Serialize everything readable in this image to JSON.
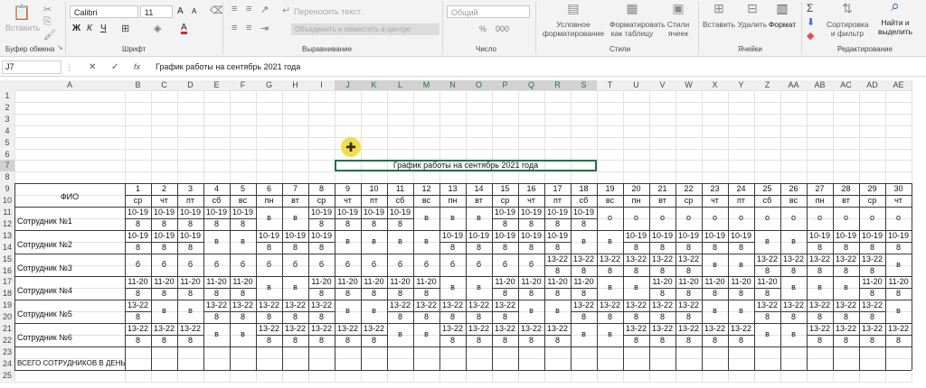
{
  "ribbon": {
    "clipboard": {
      "paste": "Вставить",
      "group": "Буфер обмена"
    },
    "font": {
      "name": "Calibri",
      "size": "11",
      "bold": "Ж",
      "italic": "К",
      "underline": "Ч",
      "grow": "A",
      "shrink": "A",
      "color_letter": "A",
      "group": "Шрифт"
    },
    "alignment": {
      "wrap": "Переносить текст",
      "merge": "Объединить и поместить в центре",
      "group": "Выравнивание"
    },
    "number": {
      "format": "Общий",
      "percent": "%",
      "thousands": "000",
      "group": "Число"
    },
    "styles": {
      "conditional": "Условное форматирование",
      "as_table": "Форматировать как таблицу",
      "cell_styles": "Стили ячеек",
      "group": "Стили"
    },
    "cells": {
      "insert": "Вставить",
      "delete": "Удалить",
      "format": "Формат",
      "group": "Ячейки"
    },
    "editing": {
      "sort": "Сортировка и фильтр",
      "find": "Найти и выделить",
      "group": "Редактирование"
    }
  },
  "formula_bar": {
    "name_box": "J7",
    "fx": "fx",
    "cancel": "✕",
    "enter": "✓",
    "content": "График работы на сентябрь 2021 года"
  },
  "sheet": {
    "columns": [
      "A",
      "B",
      "C",
      "D",
      "E",
      "F",
      "G",
      "H",
      "I",
      "J",
      "K",
      "L",
      "M",
      "N",
      "O",
      "P",
      "Q",
      "R",
      "S",
      "T",
      "U",
      "V",
      "W",
      "X",
      "Y",
      "Z",
      "AA",
      "AB",
      "AC",
      "AD",
      "AE"
    ],
    "rows": [
      "1",
      "2",
      "3",
      "4",
      "5",
      "6",
      "7",
      "8",
      "9",
      "10",
      "11",
      "12",
      "13",
      "14",
      "15",
      "16",
      "17",
      "18",
      "19",
      "20",
      "21",
      "22",
      "23",
      "24",
      "25"
    ],
    "title": "График работы на сентябрь 2021 года",
    "fio_label": "ФИО",
    "total_label": "ВСЕГО СОТРУДНИКОВ В ДЕНЬ",
    "days": [
      "1",
      "2",
      "3",
      "4",
      "5",
      "6",
      "7",
      "8",
      "9",
      "10",
      "11",
      "12",
      "13",
      "14",
      "15",
      "16",
      "17",
      "18",
      "19",
      "20",
      "21",
      "22",
      "23",
      "24",
      "25",
      "26",
      "27",
      "28",
      "29",
      "30"
    ],
    "weekdays": [
      "ср",
      "чт",
      "пт",
      "сб",
      "вс",
      "пн",
      "вт",
      "ср",
      "чт",
      "пт",
      "сб",
      "вс",
      "пн",
      "вт",
      "ср",
      "чт",
      "пт",
      "сб",
      "вс",
      "пн",
      "вт",
      "ср",
      "чт",
      "пт",
      "сб",
      "вс",
      "пн",
      "вт",
      "ср",
      "чт"
    ],
    "employees": [
      {
        "name": "Сотрудник №1",
        "days": [
          [
            "10-19",
            "8"
          ],
          [
            "10-19",
            "8"
          ],
          [
            "10-19",
            "8"
          ],
          [
            "10-19",
            "8"
          ],
          [
            "10-19",
            "8"
          ],
          [
            "в"
          ],
          [
            "в"
          ],
          [
            "10-19",
            "8"
          ],
          [
            "10-19",
            "8"
          ],
          [
            "10-19",
            "8"
          ],
          [
            "10-19",
            "8"
          ],
          [
            "в"
          ],
          [
            "в"
          ],
          [
            "в"
          ],
          [
            "10-19",
            "8"
          ],
          [
            "10-19",
            "8"
          ],
          [
            "10-19",
            "8"
          ],
          [
            "10-19",
            "8"
          ],
          [
            "о"
          ],
          [
            "о"
          ],
          [
            "о"
          ],
          [
            "о"
          ],
          [
            "о"
          ],
          [
            "о"
          ],
          [
            "о"
          ],
          [
            "о"
          ],
          [
            "о"
          ],
          [
            "о"
          ],
          [
            "о"
          ],
          [
            "о"
          ]
        ]
      },
      {
        "name": "Сотрудник №2",
        "days": [
          [
            "10-19",
            "8"
          ],
          [
            "10-19",
            "8"
          ],
          [
            "10-19",
            "8"
          ],
          [
            "в"
          ],
          [
            "в"
          ],
          [
            "10-19",
            "8"
          ],
          [
            "10-19",
            "8"
          ],
          [
            "10-19",
            "8"
          ],
          [
            "в"
          ],
          [
            "в"
          ],
          [
            "в"
          ],
          [
            "в"
          ],
          [
            "10-19",
            "8"
          ],
          [
            "10-19",
            "8"
          ],
          [
            "10-19",
            "8"
          ],
          [
            "10-19",
            "8"
          ],
          [
            "10-19",
            "8"
          ],
          [
            "в"
          ],
          [
            "в"
          ],
          [
            "10-19",
            "8"
          ],
          [
            "10-19",
            "8"
          ],
          [
            "10-19",
            "8"
          ],
          [
            "10-19",
            "8"
          ],
          [
            "10-19",
            "8"
          ],
          [
            "в"
          ],
          [
            "в"
          ],
          [
            "10-19",
            "8"
          ],
          [
            "10-19",
            "8"
          ],
          [
            "10-19",
            "8"
          ],
          [
            "10-19",
            "8"
          ]
        ]
      },
      {
        "name": "Сотрудник №3",
        "days": [
          [
            "б"
          ],
          [
            "б"
          ],
          [
            "б"
          ],
          [
            "б"
          ],
          [
            "б"
          ],
          [
            "б"
          ],
          [
            "б"
          ],
          [
            "б"
          ],
          [
            "б"
          ],
          [
            "б"
          ],
          [
            "б"
          ],
          [
            "б"
          ],
          [
            "б"
          ],
          [
            "б"
          ],
          [
            "б"
          ],
          [
            "б"
          ],
          [
            "13-22",
            "8"
          ],
          [
            "13-22",
            "8"
          ],
          [
            "13-22",
            "8"
          ],
          [
            "13-22",
            "8"
          ],
          [
            "13-22",
            "8"
          ],
          [
            "13-22",
            "8"
          ],
          [
            "в"
          ],
          [
            "в"
          ],
          [
            "13-22",
            "8"
          ],
          [
            "13-22",
            "8"
          ],
          [
            "13-22",
            "8"
          ],
          [
            "13-22",
            "8"
          ],
          [
            "13-22",
            "8"
          ],
          [
            "в"
          ]
        ]
      },
      {
        "name": "Сотрудник №4",
        "days": [
          [
            "11-20",
            "8"
          ],
          [
            "11-20",
            "8"
          ],
          [
            "11-20",
            "8"
          ],
          [
            "11-20",
            "8"
          ],
          [
            "11-20",
            "8"
          ],
          [
            "в"
          ],
          [
            "в"
          ],
          [
            "11-20",
            "8"
          ],
          [
            "11-20",
            "8"
          ],
          [
            "11-20",
            "8"
          ],
          [
            "11-20",
            "8"
          ],
          [
            "11-20",
            "8"
          ],
          [
            "в"
          ],
          [
            "в"
          ],
          [
            "11-20",
            "8"
          ],
          [
            "11-20",
            "8"
          ],
          [
            "11-20",
            "8"
          ],
          [
            "11-20",
            "8"
          ],
          [
            "в"
          ],
          [
            "в"
          ],
          [
            "11-20",
            "8"
          ],
          [
            "11-20",
            "8"
          ],
          [
            "11-20",
            "8"
          ],
          [
            "11-20",
            "8"
          ],
          [
            "11-20",
            "8"
          ],
          [
            "в"
          ],
          [
            "в"
          ],
          [
            "в"
          ],
          [
            "11-20",
            "8"
          ],
          [
            "11-20",
            "8"
          ]
        ]
      },
      {
        "name": "Сотрудник №5",
        "days": [
          [
            "13-22",
            "8"
          ],
          [
            "в"
          ],
          [
            "в"
          ],
          [
            "13-22",
            "8"
          ],
          [
            "13-22",
            "8"
          ],
          [
            "13-22",
            "8"
          ],
          [
            "13-22",
            "8"
          ],
          [
            "13-22",
            "8"
          ],
          [
            "в"
          ],
          [
            "в"
          ],
          [
            "13-22",
            "8"
          ],
          [
            "13-22",
            "8"
          ],
          [
            "13-22",
            "8"
          ],
          [
            "13-22",
            "8"
          ],
          [
            "13-22",
            "8"
          ],
          [
            "в"
          ],
          [
            "в"
          ],
          [
            "13-22",
            "8"
          ],
          [
            "13-22",
            "8"
          ],
          [
            "13-22",
            "8"
          ],
          [
            "13-22",
            "8"
          ],
          [
            "13-22",
            "8"
          ],
          [
            "в"
          ],
          [
            "в"
          ],
          [
            "13-22",
            "8"
          ],
          [
            "13-22",
            "8"
          ],
          [
            "13-22",
            "8"
          ],
          [
            "13-22",
            "8"
          ],
          [
            "13-22",
            "8"
          ],
          [
            "в"
          ]
        ]
      },
      {
        "name": "Сотрудник №6",
        "days": [
          [
            "13-22",
            "8"
          ],
          [
            "13-22",
            "8"
          ],
          [
            "13-22",
            "8"
          ],
          [
            "в"
          ],
          [
            "в"
          ],
          [
            "13-22",
            "8"
          ],
          [
            "13-22",
            "8"
          ],
          [
            "13-22",
            "8"
          ],
          [
            "13-22",
            "8"
          ],
          [
            "13-22",
            "8"
          ],
          [
            "в"
          ],
          [
            "в"
          ],
          [
            "13-22",
            "8"
          ],
          [
            "13-22",
            "8"
          ],
          [
            "13-22",
            "8"
          ],
          [
            "13-22",
            "8"
          ],
          [
            "13-22",
            "8"
          ],
          [
            "в"
          ],
          [
            "в"
          ],
          [
            "13-22",
            "8"
          ],
          [
            "13-22",
            "8"
          ],
          [
            "13-22",
            "8"
          ],
          [
            "13-22",
            "8"
          ],
          [
            "13-22",
            "8"
          ],
          [
            "в"
          ],
          [
            "в"
          ],
          [
            "13-22",
            "8"
          ],
          [
            "13-22",
            "8"
          ],
          [
            "13-22",
            "8"
          ],
          [
            "13-22",
            "8"
          ]
        ]
      }
    ]
  }
}
